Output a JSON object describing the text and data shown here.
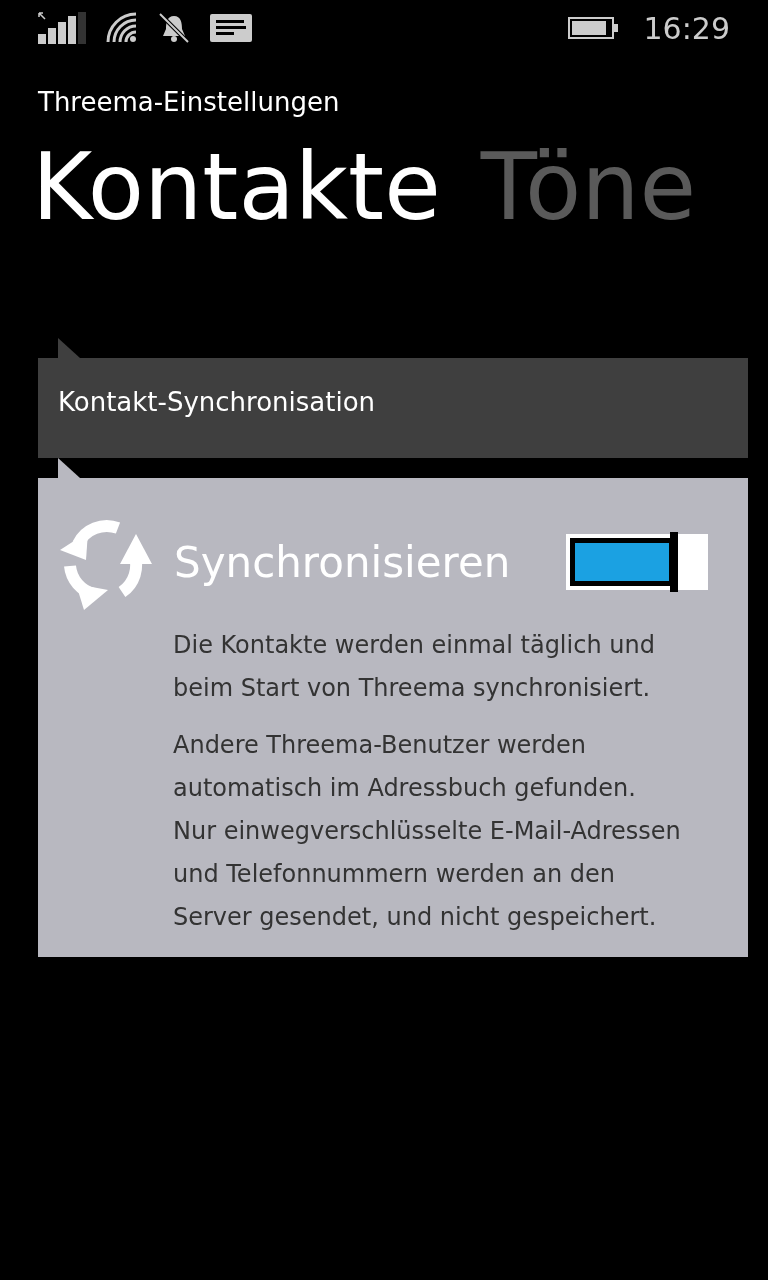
{
  "status_bar": {
    "time": "16:29"
  },
  "app_title": "Threema-Einstellungen",
  "pivot": [
    {
      "label": "Kontakte",
      "selected": true
    },
    {
      "label": "Töne",
      "selected": false
    }
  ],
  "section": {
    "title": "Kontakt-Synchronisation"
  },
  "setting": {
    "label": "Synchronisieren",
    "on": true,
    "descriptions": [
      "Die Kontakte werden einmal täglich und beim Start von Threema synchronisiert.",
      "Andere Threema-Benutzer werden automatisch im Adressbuch gefunden. Nur einwegverschlüsselte E-Mail-Adressen und Telefonnummern werden an den Server gesendet, und nicht gespeichert."
    ]
  }
}
